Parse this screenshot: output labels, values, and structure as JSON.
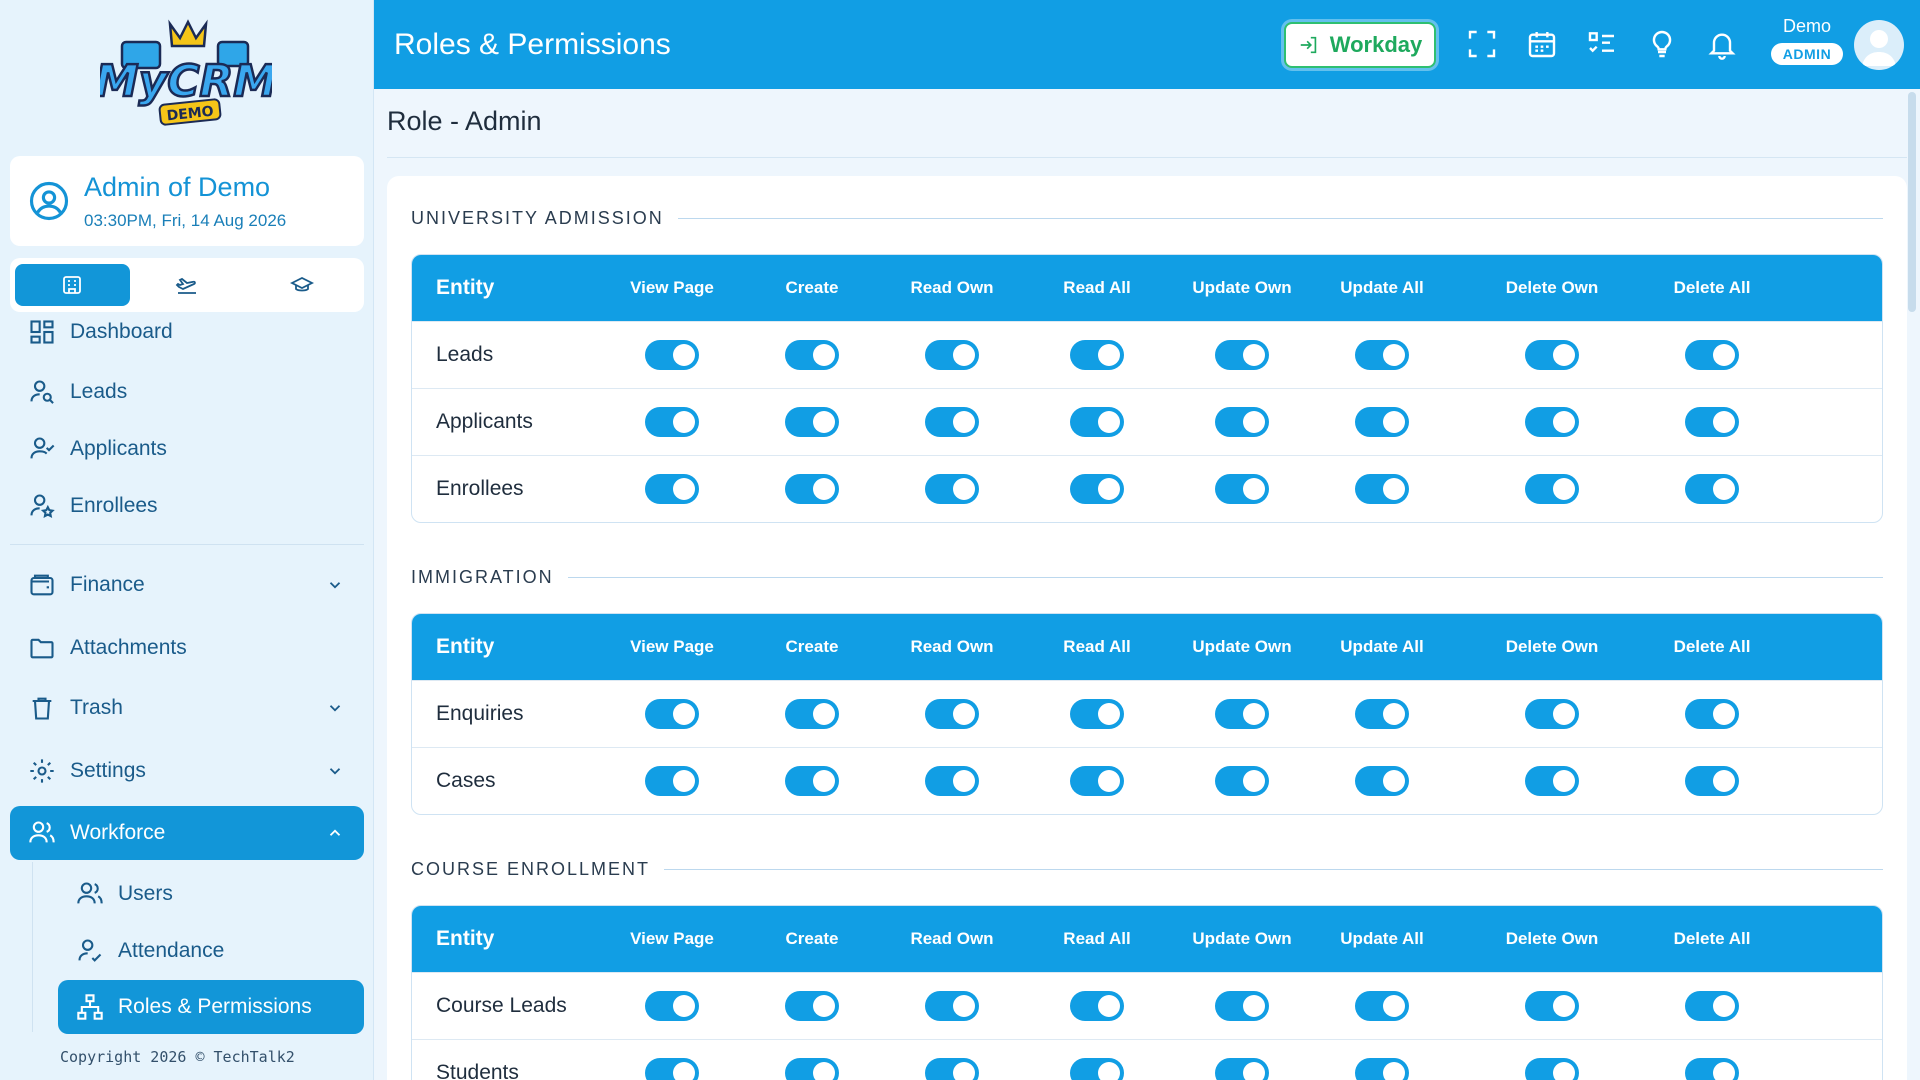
{
  "sidebar": {
    "user": {
      "name": "Admin of Demo",
      "datetime": "03:30PM, Fri, 14 Aug 2026"
    },
    "nav": {
      "dashboard": "Dashboard",
      "leads": "Leads",
      "applicants": "Applicants",
      "enrollees": "Enrollees",
      "finance": "Finance",
      "attachments": "Attachments",
      "trash": "Trash",
      "settings": "Settings",
      "workforce": "Workforce",
      "users": "Users",
      "attendance": "Attendance",
      "roles": "Roles & Permissions"
    },
    "copyright": "Copyright 2026 © TechTalk2"
  },
  "header": {
    "title": "Roles & Permissions",
    "workday_label": "Workday",
    "user_name": "Demo",
    "user_role": "ADMIN"
  },
  "page": {
    "title": "Role - Admin"
  },
  "columns": [
    "Entity",
    "View Page",
    "Create",
    "Read Own",
    "Read All",
    "Update Own",
    "Update All",
    "Delete Own",
    "Delete All"
  ],
  "sections": [
    {
      "title": "UNIVERSITY ADMISSION",
      "rows": [
        "Leads",
        "Applicants",
        "Enrollees"
      ]
    },
    {
      "title": "IMMIGRATION",
      "rows": [
        "Enquiries",
        "Cases"
      ]
    },
    {
      "title": "COURSE ENROLLMENT",
      "rows": [
        "Course Leads",
        "Students"
      ]
    }
  ],
  "colors": {
    "primary": "#119ee4",
    "sidebar_bg": "#e6f3fc",
    "workday_green": "#1ea95d"
  }
}
